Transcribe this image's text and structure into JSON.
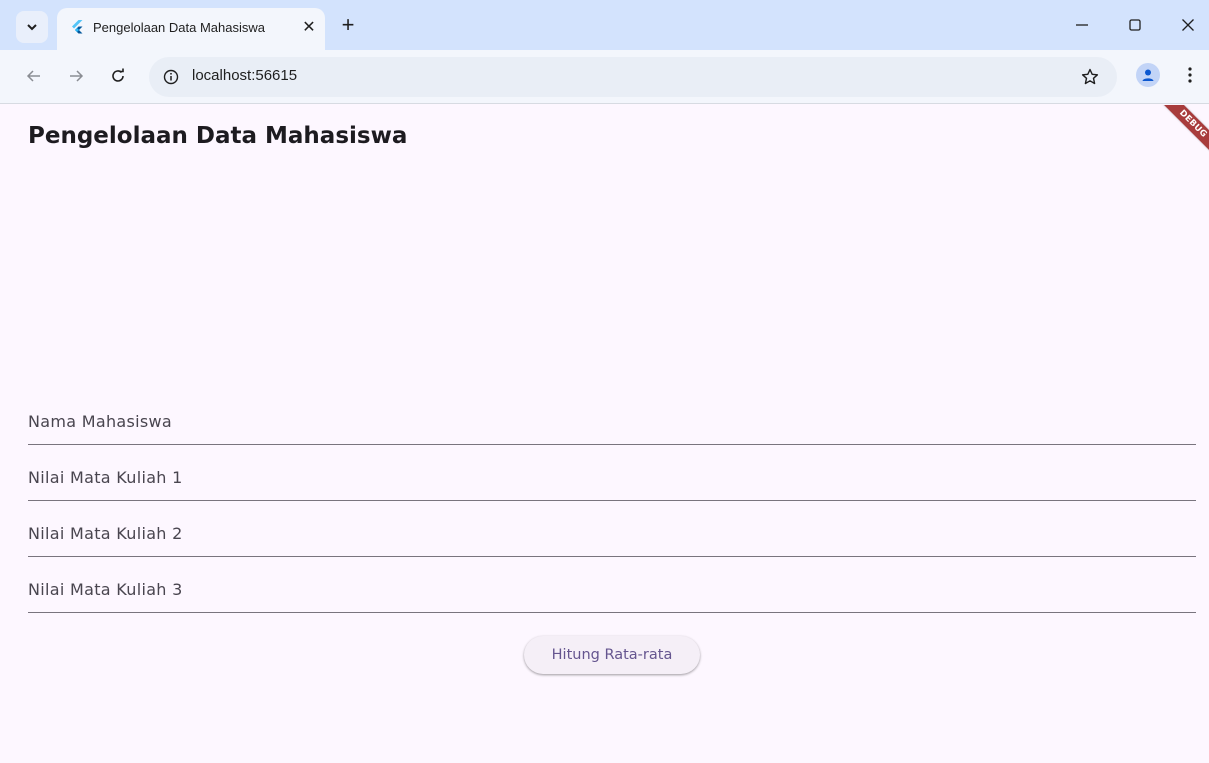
{
  "browser": {
    "tab": {
      "title": "Pengelolaan Data Mahasiswa",
      "close_glyph": "✕",
      "favicon": "flutter-icon"
    },
    "new_tab_glyph": "+",
    "url": "localhost:56615",
    "icons": {
      "tab_search": "chevron-down-icon",
      "back": "arrow-left-icon",
      "forward": "arrow-right-icon",
      "reload": "reload-icon",
      "site_info": "info-icon",
      "bookmark": "star-icon",
      "profile": "person-icon",
      "menu": "kebab-menu-icon",
      "minimize": "minimize-icon",
      "maximize": "maximize-icon",
      "close": "close-icon"
    }
  },
  "app": {
    "title": "Pengelolaan Data Mahasiswa",
    "fields": [
      {
        "label": "Nama Mahasiswa",
        "value": ""
      },
      {
        "label": "Nilai Mata Kuliah 1",
        "value": ""
      },
      {
        "label": "Nilai Mata Kuliah 2",
        "value": ""
      },
      {
        "label": "Nilai Mata Kuliah 3",
        "value": ""
      }
    ],
    "calculate_button": "Hitung Rata-rata",
    "debug_banner": "DEBUG"
  },
  "colors": {
    "tabstrip": "#d3e3fd",
    "toolbar": "#f3f6fc",
    "app_background": "#fdf7ff",
    "button_text": "#65558f",
    "debug_banner": "#a83c3c"
  }
}
